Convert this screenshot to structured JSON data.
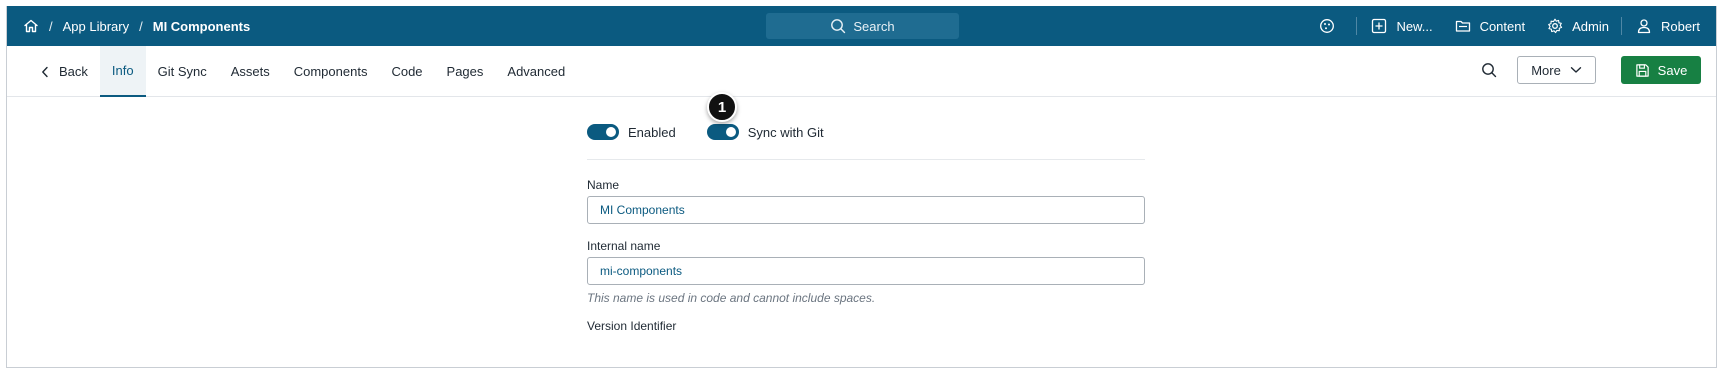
{
  "breadcrumb": {
    "items": [
      "App Library",
      "MI Components"
    ],
    "separator": "/"
  },
  "search": {
    "label": "Search"
  },
  "topnav": {
    "new": "New...",
    "content": "Content",
    "admin": "Admin",
    "user": "Robert"
  },
  "tabs": {
    "back": "Back",
    "info": "Info",
    "git_sync": "Git Sync",
    "assets": "Assets",
    "components": "Components",
    "code": "Code",
    "pages": "Pages",
    "advanced": "Advanced"
  },
  "toolbar": {
    "more": "More",
    "save": "Save"
  },
  "toggles": {
    "enabled": {
      "label": "Enabled",
      "on": true
    },
    "sync": {
      "label": "Sync with Git",
      "on": true
    }
  },
  "callout": {
    "number": "1"
  },
  "form": {
    "name": {
      "label": "Name",
      "value": "MI Components"
    },
    "internal_name": {
      "label": "Internal name",
      "value": "mi-components",
      "hint": "This name is used in code and cannot include spaces."
    },
    "version": {
      "label": "Version Identifier"
    }
  },
  "colors": {
    "brand": "#0b5a80",
    "save": "#178043"
  }
}
